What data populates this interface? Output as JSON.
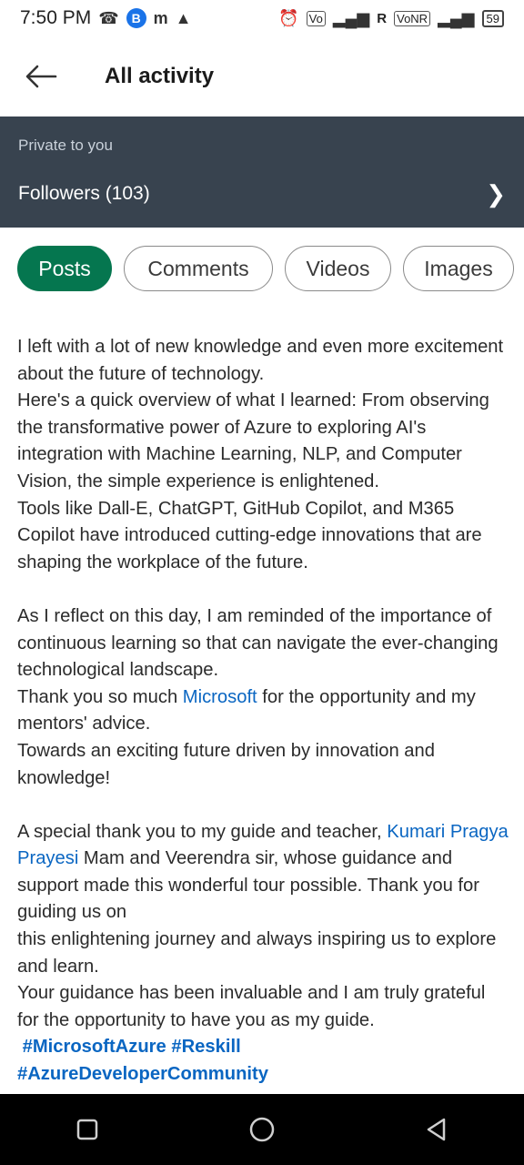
{
  "status_bar": {
    "time": "7:50 PM",
    "network_left": "R",
    "vonr": "VoNR",
    "battery": "59"
  },
  "header": {
    "title": "All activity"
  },
  "private_panel": {
    "label": "Private to you",
    "followers": "Followers (103)"
  },
  "filters": [
    {
      "label": "Posts",
      "active": true
    },
    {
      "label": "Comments",
      "active": false
    },
    {
      "label": "Videos",
      "active": false
    },
    {
      "label": "Images",
      "active": false
    }
  ],
  "post": {
    "lines": [
      "I left with a lot of new knowledge and even more excitement about the future of technology.",
      "Here's a quick overview of what I learned: From observing the transformative power of Azure to exploring AI's integration with Machine Learning, NLP, and Computer Vision, the simple experience is enlightened.",
      "Tools like Dall-E, ChatGPT, GitHub Copilot, and M365 Copilot have introduced cutting-edge innovations that are shaping the workplace of the future."
    ],
    "para2_line1": "As I reflect on this day, I am reminded of the importance of continuous learning so that can navigate the ever-changing technological landscape.",
    "thank_pre": "Thank you so much ",
    "mention_microsoft": "Microsoft",
    "thank_post": " for the opportunity and my mentors' advice.",
    "future": "Towards an exciting future driven by innovation and knowledge!",
    "special_pre": "A special thank you to my guide and teacher, ",
    "mention_guide": "Kumari Pragya Prayesi",
    "special_post": " Mam and Veerendra sir, whose guidance and support made this wonderful tour possible. Thank you for guiding us on",
    "journey": "this enlightening journey and always inspiring us to explore and learn.",
    "gratitude": "Your guidance has been invaluable and I am truly grateful for the opportunity to have you as my guide.",
    "hashtags": "#MicrosoftAzure #Reskill",
    "hashtags_cut": "#AzureDeveloperCommunity"
  }
}
